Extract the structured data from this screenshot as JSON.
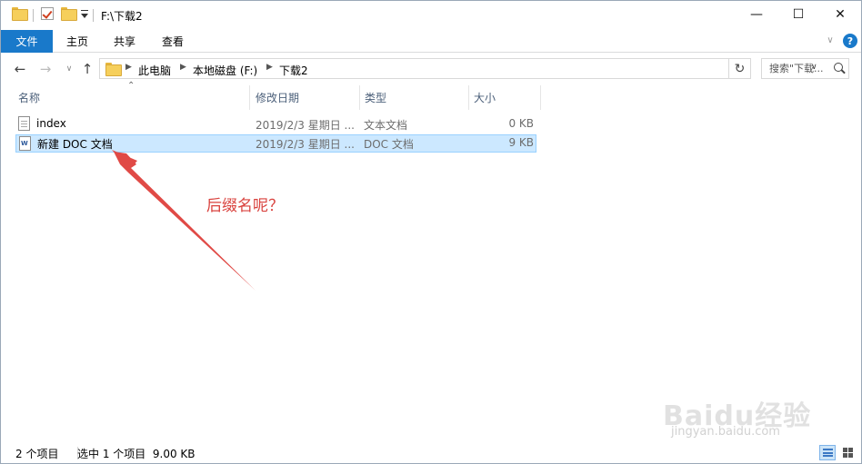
{
  "window": {
    "title": "F:\\下载2",
    "controls": {
      "minimize": "—",
      "maximize": "☐",
      "close": "✕"
    }
  },
  "ribbon": {
    "tabs": [
      "文件",
      "主页",
      "共享",
      "查看"
    ],
    "help": "?"
  },
  "address": {
    "crumbs": [
      "此电脑",
      "本地磁盘 (F:)",
      "下载2"
    ],
    "search_placeholder": "搜索\"下载..."
  },
  "columns": {
    "name": "名称",
    "date": "修改日期",
    "type": "类型",
    "size": "大小"
  },
  "files": [
    {
      "name": "index",
      "date": "2019/2/3 星期日 ...",
      "type": "文本文档",
      "size": "0 KB",
      "icon": "text-document-icon",
      "selected": false
    },
    {
      "name": "新建 DOC 文档",
      "date": "2019/2/3 星期日 ...",
      "type": "DOC 文档",
      "size": "9 KB",
      "icon": "word-document-icon",
      "selected": true
    }
  ],
  "annotation": {
    "text": "后缀名呢？",
    "color": "#d9423e"
  },
  "status": {
    "item_count": "2 个项目",
    "selection": "选中 1 个项目  9.00 KB"
  },
  "watermark": {
    "logo": "Baidu经验",
    "url": "jingyan.baidu.com"
  },
  "colors": {
    "accent": "#1979ca",
    "selection_bg": "#cce8ff",
    "selection_border": "#99d1ff"
  }
}
